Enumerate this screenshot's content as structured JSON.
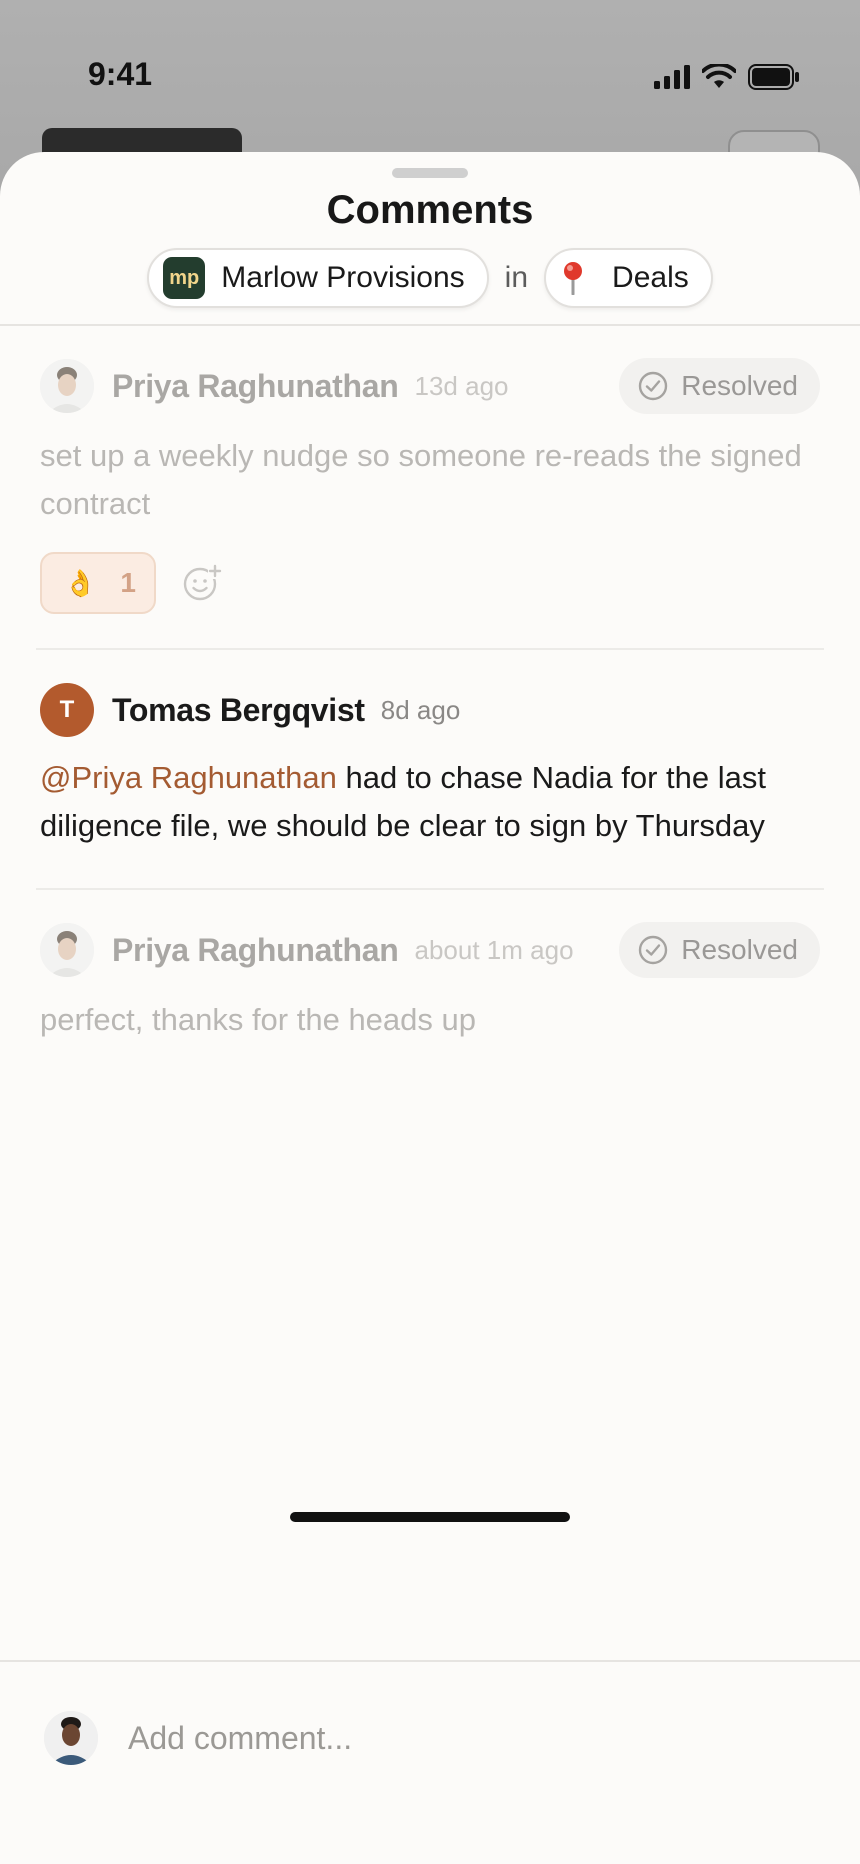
{
  "status_bar": {
    "time": "9:41"
  },
  "sheet": {
    "title": "Comments",
    "record_name": "Marlow Provisions",
    "record_logo_text": "mp",
    "in_word": "in",
    "list_name": "Deals"
  },
  "comments": [
    {
      "author": "Priya Raghunathan",
      "time": "13d ago",
      "status": "Resolved",
      "body": "set up a weekly nudge so someone re-reads the signed contract",
      "reaction": {
        "emoji": "👌",
        "count": "1"
      }
    },
    {
      "author": "Tomas Bergqvist",
      "avatar_letter": "T",
      "time": "8d ago",
      "mention": "@Priya Raghunathan",
      "body": "had to chase Nadia for the last diligence file, we should be clear to sign by Thursday"
    },
    {
      "author": "Priya Raghunathan",
      "time": "about 1m ago",
      "status": "Resolved",
      "body": "perfect, thanks for the heads up"
    }
  ],
  "composer": {
    "placeholder": "Add comment..."
  },
  "colors": {
    "accent": "#a45b32",
    "avatar_letter_bg": "#b35a2d",
    "logo_bg": "#233d2e",
    "reaction_bg": "#fbece2"
  },
  "icons": [
    "signal-icon",
    "wifi-icon",
    "battery-icon",
    "pin-icon",
    "check-circle-icon",
    "add-reaction-icon"
  ]
}
